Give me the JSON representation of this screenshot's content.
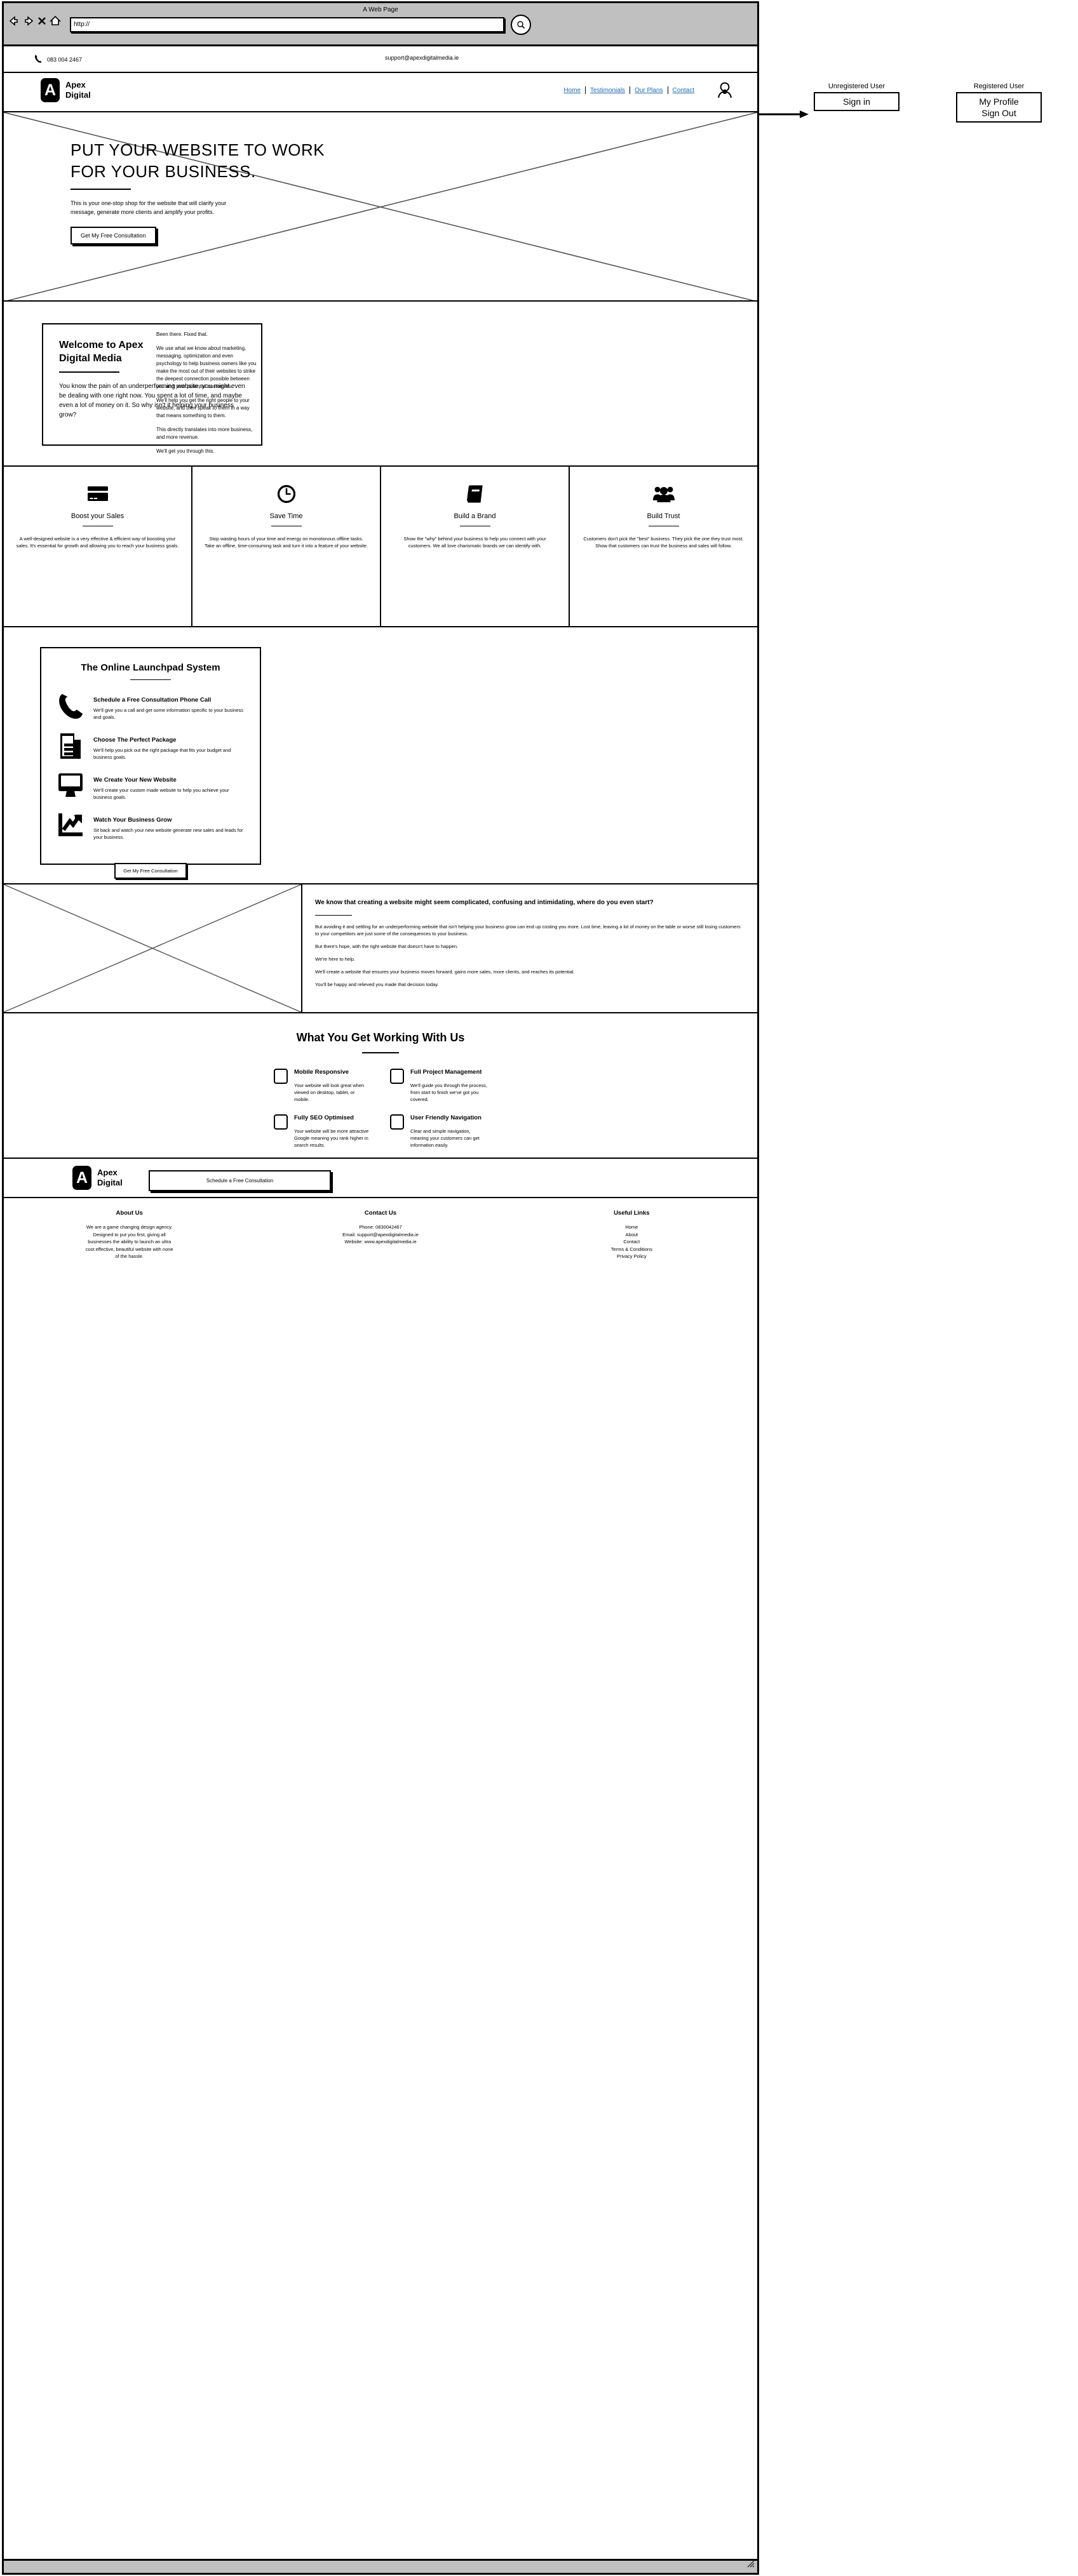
{
  "browser": {
    "window_title": "A Web Page",
    "url_value": "http://",
    "back_icon": "back-arrow-icon",
    "forward_icon": "forward-arrow-icon",
    "stop_icon": "stop-x-icon",
    "home_icon": "home-icon",
    "search_icon": "search-magnifier-icon"
  },
  "topbar": {
    "phone": "083 004 2467",
    "email": "support@apexdigitalmedia.ie",
    "phone_icon": "phone-icon"
  },
  "header": {
    "logo_mark": "A",
    "logo_line1": "Apex",
    "logo_line2": "Digital",
    "nav": [
      {
        "label": "Home"
      },
      {
        "label": "Testimonials"
      },
      {
        "label": "Our Plans"
      },
      {
        "label": "Contact"
      }
    ],
    "avatar_icon": "user-avatar-icon"
  },
  "annotations": {
    "unregistered": {
      "label": "Unregistered User",
      "items": [
        "Sign in"
      ]
    },
    "registered": {
      "label": "Registered User",
      "items": [
        "My Profile",
        "Sign Out"
      ]
    }
  },
  "hero": {
    "title": "PUT YOUR WEBSITE TO WORK FOR YOUR BUSINESS.",
    "subtitle": "This is your one-stop shop for the website that will clarify your message, generate more clients and amplify your profits.",
    "cta": "Get My Free Consultation",
    "image_placeholder": "hero-image-placeholder"
  },
  "welcome": {
    "title_line1": "Welcome to Apex",
    "title_line2": "Digital Media",
    "body": "You know the pain of an underperforming website, you might even be dealing with one right now. You spent a lot of time, and maybe even a lot of money on it. So why isn't it helping your business grow?",
    "right_paragraphs": [
      "Been there. Fixed that.",
      "We use what we know about marketing, messaging, optimization and even psychology to help business owners like you make the most out of their websites to strike the deepest connection possible between you and your potential customers.",
      "We'll help you get the right people to your website, and then speak to them in a way that means something to them.",
      "This directly translates into more business, and more revenue.",
      "We'll get you through this."
    ]
  },
  "features": [
    {
      "icon": "credit-card-icon",
      "title": "Boost your Sales",
      "body": "A well-designed website is a very effective & efficient way of boosting your sales. It's essential for growth and allowing you to reach your business goals."
    },
    {
      "icon": "clock-icon",
      "title": "Save Time",
      "body": "Stop wasting hours of your time and energy on monotonous offline tasks. Take an offline, time-consuming task and turn it into a feature of your website."
    },
    {
      "icon": "book-icon",
      "title": "Build a Brand",
      "body": "Show the \"why\" behind your business to help you connect with your customers. We all love charismatic brands we can identify with."
    },
    {
      "icon": "people-group-icon",
      "title": "Build Trust",
      "body": "Customers don't pick the \"best\" business. They pick the one they trust most. Show that customers can trust the business and sales will follow."
    }
  ],
  "launchpad": {
    "title": "The Online Launchpad System",
    "steps": [
      {
        "icon": "phone-handset-icon",
        "title": "Schedule a Free Consultation Phone Call",
        "body": "We'll give you a call and get some information specific to your business and goals."
      },
      {
        "icon": "document-icon",
        "title": "Choose The Perfect Package",
        "body": "We'll help you pick out the right package that fits your budget and business goals."
      },
      {
        "icon": "monitor-icon",
        "title": "We Create Your New Website",
        "body": "We'll create your custom made website to help you achieve your business goals."
      },
      {
        "icon": "growth-chart-icon",
        "title": "Watch Your Business Grow",
        "body": "Sit back and watch your new website generate new sales and leads for your business."
      }
    ],
    "cta": "Get My Free Consultation"
  },
  "imgtext": {
    "image_placeholder": "section-image-placeholder",
    "title": "We know that creating a website might seem complicated, confusing and intimidating, where do you even start?",
    "paragraphs": [
      "But avoiding it and settling for an underperforming website that isn't helping your business grow can end up costing you more. Lost time, leaving a lot of money on the table or worse still losing customers to your competitors are just some of the consequences to your business.",
      "But there's hope, with the right website that doesn't have to happen.",
      "We're here to help.",
      "We'll create a website that ensures your business moves forward, gains more sales, more clients, and reaches its potential.",
      "You'll be happy and relieved you made that decision today."
    ]
  },
  "whatyouget": {
    "title": "What You Get Working With Us",
    "items": [
      {
        "heading": "Mobile Responsive",
        "body": "Your website will look great when viewed on desktop, tablet, or mobile."
      },
      {
        "heading": "Full Project Management",
        "body": "We'll guide you through the process, from start to finish we've got you covered."
      },
      {
        "heading": "Fully SEO Optimised",
        "body": "Your website will be more attractive Google meaning you rank higher in search results."
      },
      {
        "heading": "User Friendly Navigation",
        "body": "Clear and simple navigation, meaning your customers can get information easily."
      }
    ]
  },
  "footer_cta": {
    "logo_mark": "A",
    "logo_line1": "Apex",
    "logo_line2": "Digital",
    "button": "Schedule a Free Consultation"
  },
  "footer": {
    "columns": [
      {
        "heading": "About Us",
        "lines": [
          "We are a game changing design agency.",
          "Designed to put you first, giving all",
          "businesses the ability to launch an ultra",
          "cost effective, beautiful website with none",
          "of the hassle."
        ]
      },
      {
        "heading": "Contact Us",
        "lines": [
          "Phone: 0830042467",
          "Email: support@apexdigitalmedia.ie",
          "Website: www.apexdigitalmedia.ie"
        ]
      },
      {
        "heading": "Useful Links",
        "lines": [
          "Home",
          "About",
          "Contact",
          "Terms & Conditions",
          "Privacy Policy"
        ]
      }
    ]
  }
}
